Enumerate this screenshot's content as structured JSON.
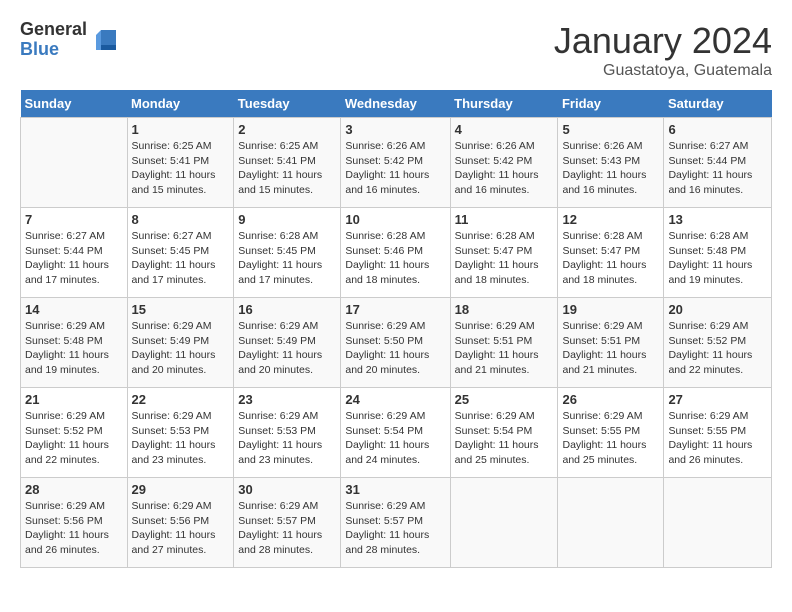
{
  "logo": {
    "general": "General",
    "blue": "Blue"
  },
  "title": "January 2024",
  "subtitle": "Guastatoya, Guatemala",
  "days_header": [
    "Sunday",
    "Monday",
    "Tuesday",
    "Wednesday",
    "Thursday",
    "Friday",
    "Saturday"
  ],
  "weeks": [
    [
      {
        "day": "",
        "sunrise": "",
        "sunset": "",
        "daylight": ""
      },
      {
        "day": "1",
        "sunrise": "Sunrise: 6:25 AM",
        "sunset": "Sunset: 5:41 PM",
        "daylight": "Daylight: 11 hours and 15 minutes."
      },
      {
        "day": "2",
        "sunrise": "Sunrise: 6:25 AM",
        "sunset": "Sunset: 5:41 PM",
        "daylight": "Daylight: 11 hours and 15 minutes."
      },
      {
        "day": "3",
        "sunrise": "Sunrise: 6:26 AM",
        "sunset": "Sunset: 5:42 PM",
        "daylight": "Daylight: 11 hours and 16 minutes."
      },
      {
        "day": "4",
        "sunrise": "Sunrise: 6:26 AM",
        "sunset": "Sunset: 5:42 PM",
        "daylight": "Daylight: 11 hours and 16 minutes."
      },
      {
        "day": "5",
        "sunrise": "Sunrise: 6:26 AM",
        "sunset": "Sunset: 5:43 PM",
        "daylight": "Daylight: 11 hours and 16 minutes."
      },
      {
        "day": "6",
        "sunrise": "Sunrise: 6:27 AM",
        "sunset": "Sunset: 5:44 PM",
        "daylight": "Daylight: 11 hours and 16 minutes."
      }
    ],
    [
      {
        "day": "7",
        "sunrise": "Sunrise: 6:27 AM",
        "sunset": "Sunset: 5:44 PM",
        "daylight": "Daylight: 11 hours and 17 minutes."
      },
      {
        "day": "8",
        "sunrise": "Sunrise: 6:27 AM",
        "sunset": "Sunset: 5:45 PM",
        "daylight": "Daylight: 11 hours and 17 minutes."
      },
      {
        "day": "9",
        "sunrise": "Sunrise: 6:28 AM",
        "sunset": "Sunset: 5:45 PM",
        "daylight": "Daylight: 11 hours and 17 minutes."
      },
      {
        "day": "10",
        "sunrise": "Sunrise: 6:28 AM",
        "sunset": "Sunset: 5:46 PM",
        "daylight": "Daylight: 11 hours and 18 minutes."
      },
      {
        "day": "11",
        "sunrise": "Sunrise: 6:28 AM",
        "sunset": "Sunset: 5:47 PM",
        "daylight": "Daylight: 11 hours and 18 minutes."
      },
      {
        "day": "12",
        "sunrise": "Sunrise: 6:28 AM",
        "sunset": "Sunset: 5:47 PM",
        "daylight": "Daylight: 11 hours and 18 minutes."
      },
      {
        "day": "13",
        "sunrise": "Sunrise: 6:28 AM",
        "sunset": "Sunset: 5:48 PM",
        "daylight": "Daylight: 11 hours and 19 minutes."
      }
    ],
    [
      {
        "day": "14",
        "sunrise": "Sunrise: 6:29 AM",
        "sunset": "Sunset: 5:48 PM",
        "daylight": "Daylight: 11 hours and 19 minutes."
      },
      {
        "day": "15",
        "sunrise": "Sunrise: 6:29 AM",
        "sunset": "Sunset: 5:49 PM",
        "daylight": "Daylight: 11 hours and 20 minutes."
      },
      {
        "day": "16",
        "sunrise": "Sunrise: 6:29 AM",
        "sunset": "Sunset: 5:49 PM",
        "daylight": "Daylight: 11 hours and 20 minutes."
      },
      {
        "day": "17",
        "sunrise": "Sunrise: 6:29 AM",
        "sunset": "Sunset: 5:50 PM",
        "daylight": "Daylight: 11 hours and 20 minutes."
      },
      {
        "day": "18",
        "sunrise": "Sunrise: 6:29 AM",
        "sunset": "Sunset: 5:51 PM",
        "daylight": "Daylight: 11 hours and 21 minutes."
      },
      {
        "day": "19",
        "sunrise": "Sunrise: 6:29 AM",
        "sunset": "Sunset: 5:51 PM",
        "daylight": "Daylight: 11 hours and 21 minutes."
      },
      {
        "day": "20",
        "sunrise": "Sunrise: 6:29 AM",
        "sunset": "Sunset: 5:52 PM",
        "daylight": "Daylight: 11 hours and 22 minutes."
      }
    ],
    [
      {
        "day": "21",
        "sunrise": "Sunrise: 6:29 AM",
        "sunset": "Sunset: 5:52 PM",
        "daylight": "Daylight: 11 hours and 22 minutes."
      },
      {
        "day": "22",
        "sunrise": "Sunrise: 6:29 AM",
        "sunset": "Sunset: 5:53 PM",
        "daylight": "Daylight: 11 hours and 23 minutes."
      },
      {
        "day": "23",
        "sunrise": "Sunrise: 6:29 AM",
        "sunset": "Sunset: 5:53 PM",
        "daylight": "Daylight: 11 hours and 23 minutes."
      },
      {
        "day": "24",
        "sunrise": "Sunrise: 6:29 AM",
        "sunset": "Sunset: 5:54 PM",
        "daylight": "Daylight: 11 hours and 24 minutes."
      },
      {
        "day": "25",
        "sunrise": "Sunrise: 6:29 AM",
        "sunset": "Sunset: 5:54 PM",
        "daylight": "Daylight: 11 hours and 25 minutes."
      },
      {
        "day": "26",
        "sunrise": "Sunrise: 6:29 AM",
        "sunset": "Sunset: 5:55 PM",
        "daylight": "Daylight: 11 hours and 25 minutes."
      },
      {
        "day": "27",
        "sunrise": "Sunrise: 6:29 AM",
        "sunset": "Sunset: 5:55 PM",
        "daylight": "Daylight: 11 hours and 26 minutes."
      }
    ],
    [
      {
        "day": "28",
        "sunrise": "Sunrise: 6:29 AM",
        "sunset": "Sunset: 5:56 PM",
        "daylight": "Daylight: 11 hours and 26 minutes."
      },
      {
        "day": "29",
        "sunrise": "Sunrise: 6:29 AM",
        "sunset": "Sunset: 5:56 PM",
        "daylight": "Daylight: 11 hours and 27 minutes."
      },
      {
        "day": "30",
        "sunrise": "Sunrise: 6:29 AM",
        "sunset": "Sunset: 5:57 PM",
        "daylight": "Daylight: 11 hours and 28 minutes."
      },
      {
        "day": "31",
        "sunrise": "Sunrise: 6:29 AM",
        "sunset": "Sunset: 5:57 PM",
        "daylight": "Daylight: 11 hours and 28 minutes."
      },
      {
        "day": "",
        "sunrise": "",
        "sunset": "",
        "daylight": ""
      },
      {
        "day": "",
        "sunrise": "",
        "sunset": "",
        "daylight": ""
      },
      {
        "day": "",
        "sunrise": "",
        "sunset": "",
        "daylight": ""
      }
    ]
  ]
}
